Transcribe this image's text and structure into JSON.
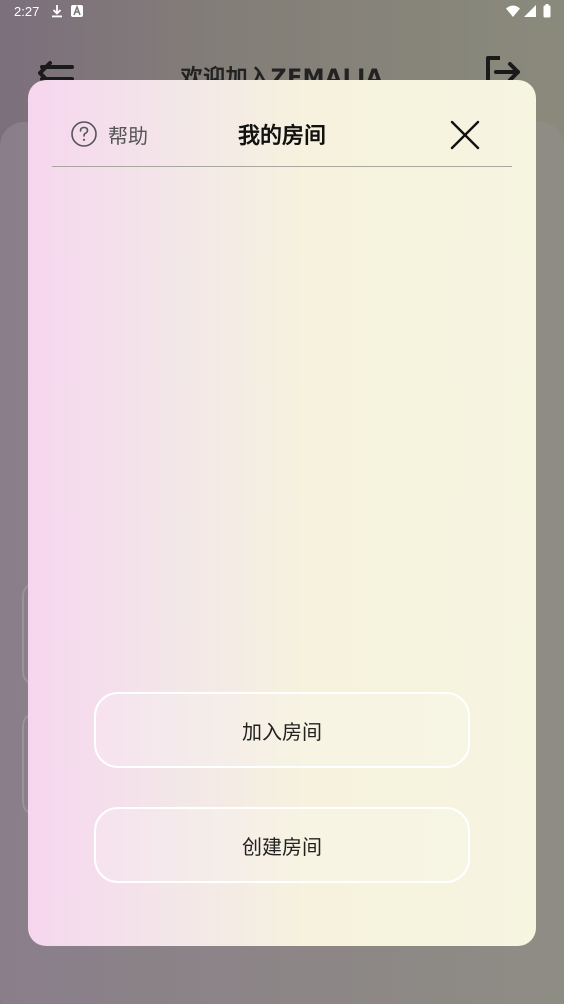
{
  "status_bar": {
    "time": "2:27",
    "icons": [
      "download-icon",
      "a-icon",
      "square-icon",
      "wifi-icon",
      "signal-icon",
      "battery-icon"
    ]
  },
  "background": {
    "title": "欢迎加入ZEMALIA",
    "back_icon": "menu-back-icon",
    "exit_icon": "logout-icon"
  },
  "modal": {
    "title": "我的房间",
    "help_label": "帮助",
    "help_icon": "question-circle-icon",
    "close_icon": "close-icon",
    "buttons": {
      "join": "加入房间",
      "create": "创建房间"
    }
  },
  "colors": {
    "modal_gradient_left": "#f6d6ef",
    "modal_gradient_right": "#f6f5e0",
    "button_border": "#ffffff",
    "title_text": "#111111"
  }
}
